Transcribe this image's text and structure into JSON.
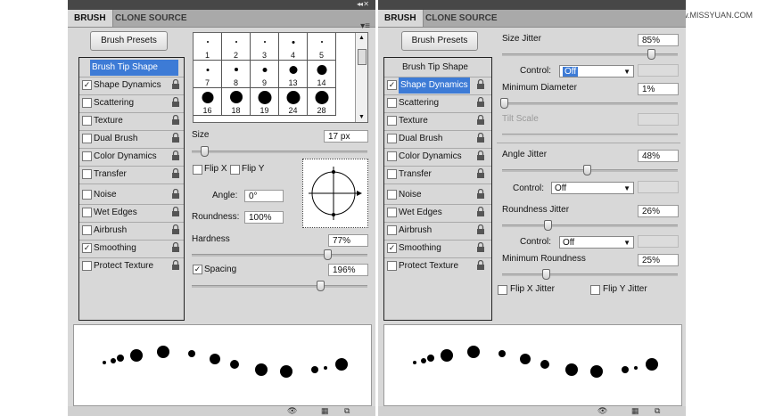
{
  "watermark": "思缘设计论坛 www.MISSYUAN.COM",
  "left": {
    "tabs": [
      "BRUSH",
      "CLONE SOURCE"
    ],
    "menu_icon": "panel-menu-icon",
    "presets_label": "Brush Presets",
    "sidebar": [
      {
        "label": "Brush Tip Shape",
        "checked": null,
        "lock": false,
        "state": "header-selected"
      },
      {
        "label": "Shape Dynamics",
        "checked": true,
        "lock": true
      },
      {
        "label": "Scattering",
        "checked": false,
        "lock": true
      },
      {
        "label": "Texture",
        "checked": false,
        "lock": true
      },
      {
        "label": "Dual Brush",
        "checked": false,
        "lock": true
      },
      {
        "label": "Color Dynamics",
        "checked": false,
        "lock": true
      },
      {
        "label": "Transfer",
        "checked": false,
        "lock": true
      },
      {
        "label": "Noise",
        "checked": false,
        "lock": true
      },
      {
        "label": "Wet Edges",
        "checked": false,
        "lock": true
      },
      {
        "label": "Airbrush",
        "checked": false,
        "lock": true
      },
      {
        "label": "Smoothing",
        "checked": true,
        "lock": true
      },
      {
        "label": "Protect Texture",
        "checked": false,
        "lock": true
      }
    ],
    "tips": [
      {
        "n": "1",
        "d": 1
      },
      {
        "n": "2",
        "d": 1
      },
      {
        "n": "3",
        "d": 2
      },
      {
        "n": "4",
        "d": 3
      },
      {
        "n": "5",
        "d": 1
      },
      {
        "n": "7",
        "d": 3
      },
      {
        "n": "8",
        "d": 4
      },
      {
        "n": "9",
        "d": 5
      },
      {
        "n": "13",
        "d": 9
      },
      {
        "n": "14",
        "d": 11
      },
      {
        "n": "16",
        "d": 13
      },
      {
        "n": "18",
        "d": 14
      },
      {
        "n": "19",
        "d": 15
      },
      {
        "n": "24",
        "d": 15
      },
      {
        "n": "28",
        "d": 15
      }
    ],
    "size_label": "Size",
    "size_value": "17 px",
    "size_slider": 0.07,
    "flipx_label": "Flip X",
    "flipy_label": "Flip Y",
    "angle_label": "Angle:",
    "angle_value": "0°",
    "roundness_label": "Roundness:",
    "roundness_value": "100%",
    "hardness_label": "Hardness",
    "hardness_value": "77%",
    "hardness_slider": 0.77,
    "spacing_label": "Spacing",
    "spacing_checked": true,
    "spacing_value": "196%",
    "spacing_slider": 0.73
  },
  "right": {
    "tabs": [
      "BRUSH",
      "CLONE SOURCE"
    ],
    "presets_label": "Brush Presets",
    "sidebar": [
      {
        "label": "Brush Tip Shape",
        "checked": null,
        "lock": false,
        "state": "header"
      },
      {
        "label": "Shape Dynamics",
        "checked": true,
        "lock": true,
        "state": "selected"
      },
      {
        "label": "Scattering",
        "checked": false,
        "lock": true
      },
      {
        "label": "Texture",
        "checked": false,
        "lock": true
      },
      {
        "label": "Dual Brush",
        "checked": false,
        "lock": true
      },
      {
        "label": "Color Dynamics",
        "checked": false,
        "lock": true
      },
      {
        "label": "Transfer",
        "checked": false,
        "lock": true
      },
      {
        "label": "Noise",
        "checked": false,
        "lock": true
      },
      {
        "label": "Wet Edges",
        "checked": false,
        "lock": true
      },
      {
        "label": "Airbrush",
        "checked": false,
        "lock": true
      },
      {
        "label": "Smoothing",
        "checked": true,
        "lock": true
      },
      {
        "label": "Protect Texture",
        "checked": false,
        "lock": true
      }
    ],
    "size_jitter_label": "Size Jitter",
    "size_jitter_value": "85%",
    "size_jitter_slider": 0.85,
    "control_label": "Control:",
    "control1_value": "Off",
    "min_diameter_label": "Minimum Diameter",
    "min_diameter_value": "1%",
    "min_diameter_slider": 0.01,
    "tilt_scale_label": "Tilt Scale",
    "angle_jitter_label": "Angle Jitter",
    "angle_jitter_value": "48%",
    "angle_jitter_slider": 0.48,
    "control2_value": "Off",
    "roundness_jitter_label": "Roundness Jitter",
    "roundness_jitter_value": "26%",
    "roundness_jitter_slider": 0.26,
    "control3_value": "Off",
    "min_roundness_label": "Minimum Roundness",
    "min_roundness_value": "25%",
    "min_roundness_slider": 0.25,
    "flipx_jitter_label": "Flip X Jitter",
    "flipy_jitter_label": "Flip Y Jitter"
  },
  "colors": {
    "panel": "#d8d8d8",
    "selected": "#3d7bd6",
    "tabbar": "#a9a9a9"
  }
}
